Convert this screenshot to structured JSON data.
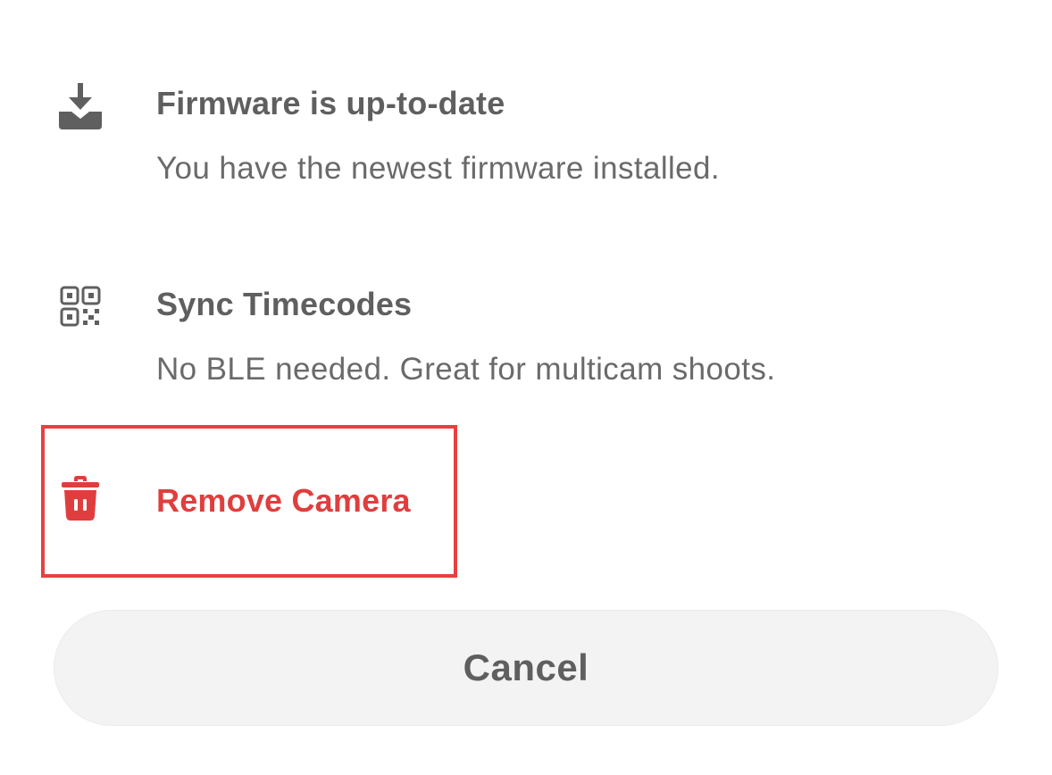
{
  "options": {
    "firmware": {
      "icon": "download-icon",
      "title": "Firmware is up-to-date",
      "subtitle": "You have the newest firmware installed."
    },
    "sync": {
      "icon": "qr-code-icon",
      "title": "Sync Timecodes",
      "subtitle": "No BLE needed. Great for multicam shoots."
    },
    "remove": {
      "icon": "trash-icon",
      "title": "Remove Camera"
    }
  },
  "cancel_label": "Cancel",
  "colors": {
    "text_primary": "#5f5f5f",
    "text_secondary": "#6a6a6a",
    "danger": "#e03e3e",
    "highlight_border": "#e8403f",
    "button_bg": "#f3f3f3",
    "icon": "#5f5f5f"
  }
}
